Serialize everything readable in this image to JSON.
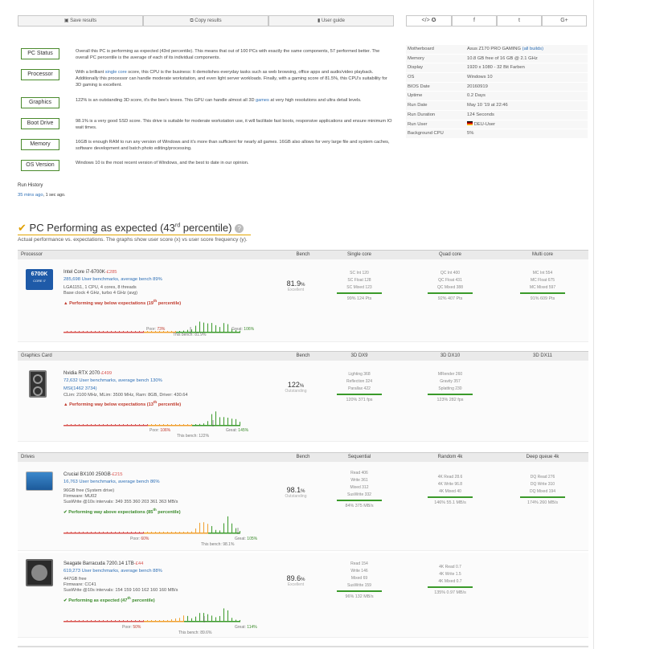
{
  "toolbar": {
    "save": "Save results",
    "copy": "Copy results",
    "guide": "User guide"
  },
  "share": [
    "</>  ✪",
    "f",
    "t",
    "G+"
  ],
  "tabs": {
    "pc_status": "PC Status",
    "processor": "Processor",
    "graphics": "Graphics",
    "boot_drive": "Boot Drive",
    "memory": "Memory",
    "os_version": "OS Version"
  },
  "summary": {
    "pc_status": "Overall this PC is performing as expected (43rd percentile). This means that out of 100 PCs with exactly the same components, 57 performed better. The overall PC percentile is the average of each of its individual components.",
    "processor_a": "With a brilliant ",
    "processor_link": "single core",
    "processor_b": " score, this CPU is the business: It demolishes everyday tasks such as web browsing, office apps and audio/video playback. Additionally this processor can handle moderate workstation, and even light server workloads. Finally, with a gaming score of 81.5%, this CPU's suitability for 3D gaming is excellent.",
    "graphics_a": "122% is an outstanding 3D score, it's the bee's knees. This GPU can handle almost all 3D ",
    "graphics_link": "games",
    "graphics_b": " at very high resolutions and ultra detail levels.",
    "boot": "98.1% is a very good SSD score. This drive is suitable for moderate workstation use, it will facilitate fast boots, responsive applications and ensure minimum IO wait times.",
    "memory": "16GB is enough RAM to run any version of Windows and it's more than sufficient for nearly all games. 16GB also allows for very large file and system caches, software development and batch photo editing/processing.",
    "os": "Windows 10 is the most recent version of Windows, and the best to date in our opinion."
  },
  "run_history": {
    "title": "Run History",
    "mins": "35 mins ago",
    "sep": ", ",
    "secs": "1 sec ago."
  },
  "info": [
    {
      "k": "Motherboard",
      "v": "Asus Z170 PRO GAMING",
      "extra": "(all builds)"
    },
    {
      "k": "Memory",
      "v": "10.8 GB free of 16 GB @ 2.1 GHz",
      "extra": ""
    },
    {
      "k": "Display",
      "v": "1920 x 1080 - 32 Bit Farben",
      "extra": ""
    },
    {
      "k": "OS",
      "v": "Windows 10",
      "extra": ""
    },
    {
      "k": "BIOS Date",
      "v": "20160919",
      "extra": ""
    },
    {
      "k": "Uptime",
      "v": "0.2 Days",
      "extra": ""
    },
    {
      "k": "Run Date",
      "v": "May 10 '19 at 22:46",
      "extra": ""
    },
    {
      "k": "Run Duration",
      "v": "124 Seconds",
      "extra": ""
    },
    {
      "k": "Run User",
      "v": "DEU-User",
      "extra": ""
    },
    {
      "k": "Background CPU",
      "v": "5%",
      "extra": ""
    }
  ],
  "perf": {
    "check": "✔",
    "title_a": "PC Performing as expected (43",
    "title_sup": "rd",
    "title_b": " percentile)",
    "help": "?",
    "subtitle": "Actual performance vs. expectations. The graphs show user score (x) vs user score frequency (y)."
  },
  "cpu": {
    "header": {
      "name": "Processor",
      "bench": "Bench",
      "c1": "Single core",
      "c2": "Quad core",
      "c3": "Multi core"
    },
    "badge_top": "6700K",
    "badge_bot": "CORE i7",
    "title": "Intel Core i7-6700K",
    "price": "-£285",
    "link": "285,698 User benchmarks, average bench 89%",
    "spec1": "LGA1151, 1 CPU, 4 cores, 8 threads",
    "spec2": "Base clock 4 GHz, turbo 4 GHz (avg)",
    "status_a": "▲ Performing way below expectations (19",
    "status_sup": "th",
    "status_b": " percentile)",
    "score": "81.9",
    "unit": "%",
    "rating": "Excellent",
    "m1": [
      "SC Int 120",
      "SC Float 128",
      "SC Mixed 123"
    ],
    "m1r": "99% 124 Pts",
    "m2": [
      "QC Int 400",
      "QC Float 431",
      "QC Mixed 388"
    ],
    "m2r": "92% 407 Pts",
    "m3": [
      "MC Int 554",
      "MC Float 675",
      "MC Mixed 597"
    ],
    "m3r": "91% 609 Pts",
    "poor": "Poor:",
    "poor_v": "73%",
    "great": "Great:",
    "great_v": "106%",
    "this": "This bench: 81.9%"
  },
  "gpu": {
    "header": {
      "name": "Graphics Card",
      "bench": "Bench",
      "c1": "3D DX9",
      "c2": "3D DX10",
      "c3": "3D DX11"
    },
    "title": "Nvidia RTX 2070",
    "price": "-£499",
    "link": "72,632 User benchmarks, average bench 130%",
    "link2": "MSI(1462 3734)",
    "spec1": "CLim: 2100 MHz, MLim: 3500 MHz, Ram: 8GB, Driver: 430.64",
    "status_a": "▲ Performing way below expectations (13",
    "status_sup": "th",
    "status_b": " percentile)",
    "score": "122",
    "unit": "%",
    "rating": "Outstanding",
    "m1": [
      "Lighting 368",
      "Reflection 324",
      "Parallax 422"
    ],
    "m1r": "120% 371 fps",
    "m2": [
      "MRender 260",
      "Gravity 357",
      "Splatting 230"
    ],
    "m2r": "123% 282 fps",
    "poor": "Poor:",
    "poor_v": "106%",
    "great": "Great:",
    "great_v": "145%",
    "this": "This bench: 122%"
  },
  "drives": {
    "header": {
      "name": "Drives",
      "bench": "Bench",
      "c1": "Sequential",
      "c2": "Random 4k",
      "c3": "Deep queue 4k"
    },
    "ssd": {
      "title": "Crucial BX100 250GB",
      "price": "-£215",
      "link": "16,763 User benchmarks, average bench 86%",
      "spec1": "96GB free (System drive)",
      "spec2": "Firmware: MU02",
      "spec3": "SusWrite @10s intervals: 349 355 360 203 361 363 MB/s",
      "status_a": "✔ Performing way above expectations (85",
      "status_sup": "th",
      "status_b": " percentile)",
      "score": "98.1",
      "unit": "%",
      "rating": "Outstanding",
      "m1": [
        "Read 406",
        "Write 361",
        "Mixed 312",
        "SusWrite 332"
      ],
      "m1r": "84% 375 MB/s",
      "m2": [
        "4K Read 28.6",
        "4K Write 96.8",
        "4K Mixed 40"
      ],
      "m2r": "146% 55.1 MB/s",
      "m3": [
        "DQ Read 276",
        "DQ Write 310",
        "DQ Mixed 194"
      ],
      "m3r": "174% 260 MB/s",
      "poor": "Poor:",
      "poor_v": "60%",
      "great": "Great:",
      "great_v": "105%",
      "this": "This bench: 98.1%"
    },
    "hdd": {
      "title": "Seagate Barracuda 7200.14 1TB",
      "price": "-£44",
      "link": "619,273 User benchmarks, average bench 88%",
      "spec1": "447GB free",
      "spec2": "Firmware: CC41",
      "spec3": "SusWrite @10s intervals: 154 159 160 162 160 160 MB/s",
      "status_a": "✔ Performing as expected (47",
      "status_sup": "th",
      "status_b": " percentile)",
      "score": "89.6",
      "unit": "%",
      "rating": "Excellent",
      "m1": [
        "Read 154",
        "Write 146",
        "Mixed 69",
        "SusWrite 159"
      ],
      "m1r": "96% 132 MB/s",
      "m2": [
        "4K Read 0.7",
        "4K Write 1.5",
        "4K Mixed 0.7"
      ],
      "m2r": "135% 0.97 MB/s",
      "poor": "Poor:",
      "poor_v": "50%",
      "great": "Great:",
      "great_v": "114%",
      "this": "This bench: 89.6%"
    }
  },
  "colors": {
    "green": "#3a9a2a",
    "red": "#d9534f",
    "orange": "#f0a030",
    "link": "#2d6fb6"
  },
  "icons": [
    "floppy-icon",
    "copy-icon",
    "book-icon",
    "share-icon",
    "facebook-icon",
    "twitter-icon",
    "googleplus-icon",
    "help-icon",
    "check-icon",
    "warning-icon",
    "flag-icon"
  ]
}
